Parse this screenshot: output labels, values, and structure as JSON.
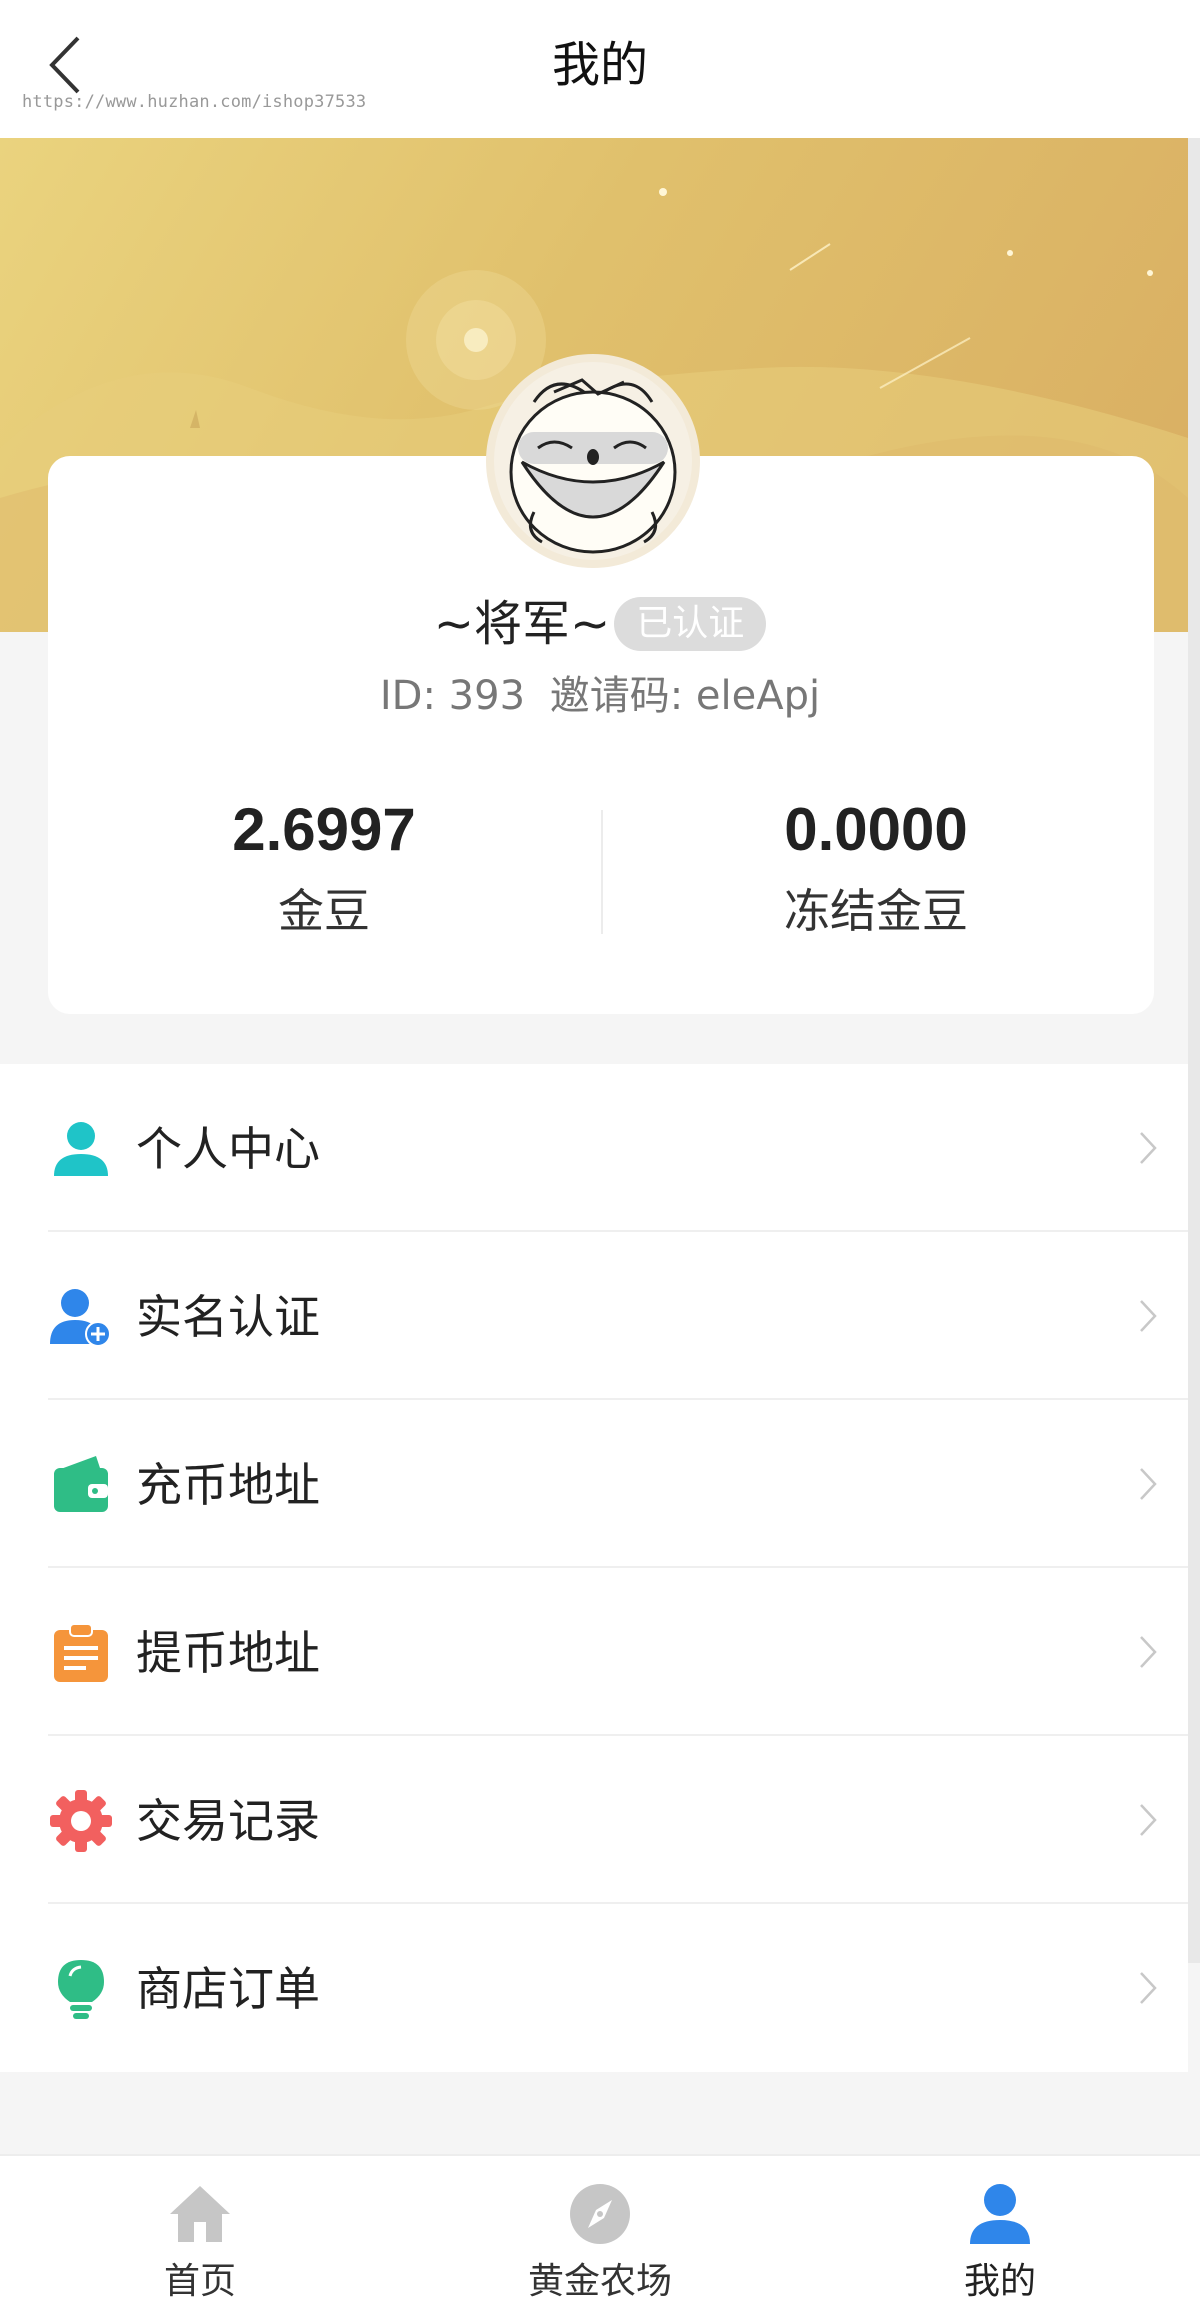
{
  "header": {
    "title": "我的",
    "watermark": "https://www.huzhan.com/ishop37533"
  },
  "profile": {
    "nickname": "~将军~",
    "verified_label": "已认证",
    "id_text": "ID: 393",
    "invite_text": "邀请码: eleApj"
  },
  "stats": [
    {
      "value": "2.6997",
      "label": "金豆"
    },
    {
      "value": "0.0000",
      "label": "冻结金豆"
    }
  ],
  "menu": {
    "items": [
      {
        "label": "个人中心",
        "icon": "person-icon",
        "color": "#1fc4c8"
      },
      {
        "label": "实名认证",
        "icon": "add-user-icon",
        "color": "#2f86ea"
      },
      {
        "label": "充币地址",
        "icon": "wallet-icon",
        "color": "#2fbd86"
      },
      {
        "label": "提币地址",
        "icon": "clipboard-icon",
        "color": "#f5953b"
      },
      {
        "label": "交易记录",
        "icon": "gear-icon",
        "color": "#f2605f"
      },
      {
        "label": "商店订单",
        "icon": "lightbulb-icon",
        "color": "#2fbd86"
      }
    ]
  },
  "tabbar": {
    "tabs": [
      {
        "label": "首页",
        "icon": "home-icon",
        "active": false
      },
      {
        "label": "黄金农场",
        "icon": "compass-icon",
        "active": false
      },
      {
        "label": "我的",
        "icon": "user-icon",
        "active": true
      }
    ],
    "active_color": "#2f86ea",
    "inactive_color": "#c6c6c6"
  }
}
